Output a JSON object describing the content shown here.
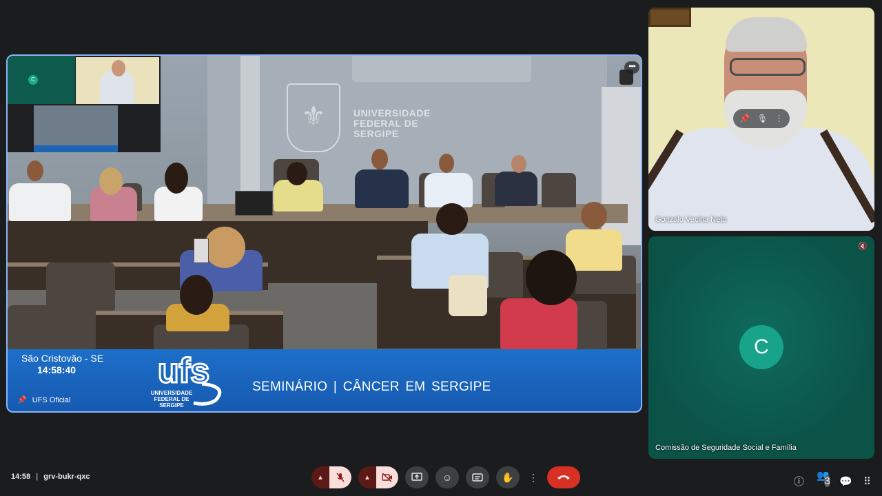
{
  "main_tile": {
    "institution_text": "UNIVERSIDADE FEDERAL DE SERGIPE",
    "institution_lines": [
      "UNIVERSIDADE",
      "FEDERAL DE",
      "SERGIPE"
    ],
    "banner": {
      "location": "São Cristovão - SE",
      "clock": "14:58:40",
      "logo_text": "ufs",
      "logo_subtitle": "UNIVERSIDADE FEDERAL DE SERGIPE",
      "title": "SEMINÁRIO |  CÂNCER  EM  SERGIPE",
      "pinned_label": "UFS Oficial"
    },
    "pip": {
      "avatar_letter": "C"
    }
  },
  "participants": [
    {
      "name": "Gonzalo Vecina Neto"
    },
    {
      "name": "Comissão de Seguridade Social e Família",
      "avatar_letter": "C"
    }
  ],
  "bottom_bar": {
    "time": "14:58",
    "meeting_code": "grv-bukr-qxc",
    "people_count": "3"
  },
  "icons": {
    "pin": "pin-icon",
    "mic_off": "mic-off-icon",
    "cam_off": "camera-off-icon",
    "present": "present-screen-icon",
    "emoji": "emoji-icon",
    "captions": "captions-icon",
    "raise_hand": "raise-hand-icon",
    "more": "more-vert-icon",
    "hangup": "hang-up-icon",
    "info": "info-icon",
    "people": "people-icon",
    "chat": "chat-icon",
    "activities": "activities-icon"
  },
  "colors": {
    "accent_border": "#8ab4f8",
    "banner_blue": "#1d6fc9",
    "hangup_red": "#d93025",
    "avatar_teal": "#17a48b"
  }
}
